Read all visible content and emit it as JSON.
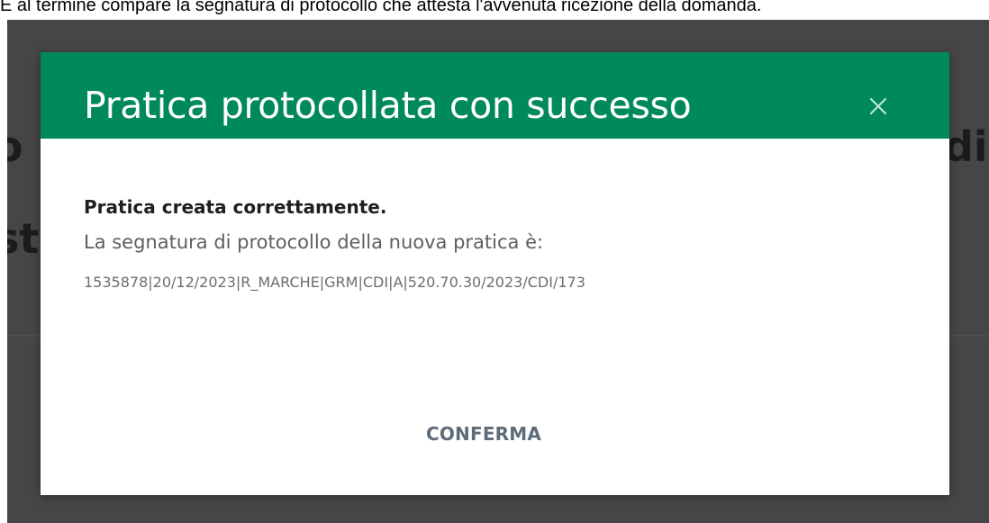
{
  "document": {
    "caption": "E al termine compare la segnatura di protocollo che attesta l'avvenuta ricezione della domanda."
  },
  "background": {
    "fragment_left_1": "o",
    "fragment_left_2": "st",
    "fragment_right_1": "di"
  },
  "modal": {
    "title": "Pratica protocollata con successo",
    "close_icon": "close-icon",
    "body_title": "Pratica creata correttamente.",
    "body_text": "La segnatura di protocollo della nuova pratica è:",
    "protocol_signature": "1535878|20/12/2023|R_MARCHE|GRM|CDI|A|520.70.30/2023/CDI/173",
    "confirm_label": "CONFERMA"
  },
  "colors": {
    "header_green": "#00895a",
    "overlay": "#464646",
    "confirm_text": "#5e6b78"
  }
}
